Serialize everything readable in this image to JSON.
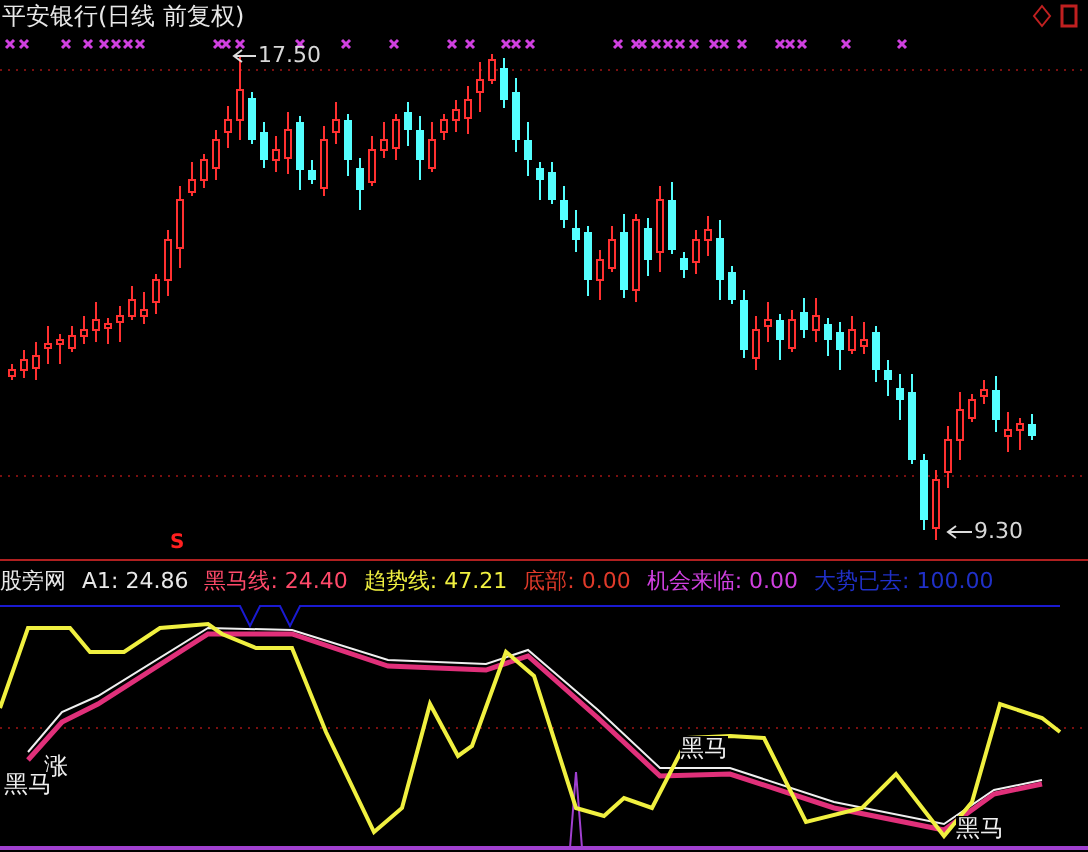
{
  "chart": {
    "title": "平安银行(日线 前复权)",
    "high_label": "17.50",
    "low_label": "9.30",
    "signal": "S"
  },
  "indicator": {
    "name": "股旁网",
    "readings": [
      {
        "text": "A1: 24.86",
        "color": "#e8e8e8"
      },
      {
        "text": "黑马线: 24.40",
        "color": "#ff4a6a"
      },
      {
        "text": "趋势线: 47.21",
        "color": "#f0f040"
      },
      {
        "text": "底部: 0.00",
        "color": "#e03a2a"
      },
      {
        "text": "机会来临: 0.00",
        "color": "#d040e0"
      },
      {
        "text": "大势已去: 100.00",
        "color": "#2030c8"
      }
    ]
  },
  "lower_labels": [
    {
      "text": "涨"
    },
    {
      "text": "黑马"
    },
    {
      "text": "黑马"
    },
    {
      "text": "黑马"
    }
  ]
}
